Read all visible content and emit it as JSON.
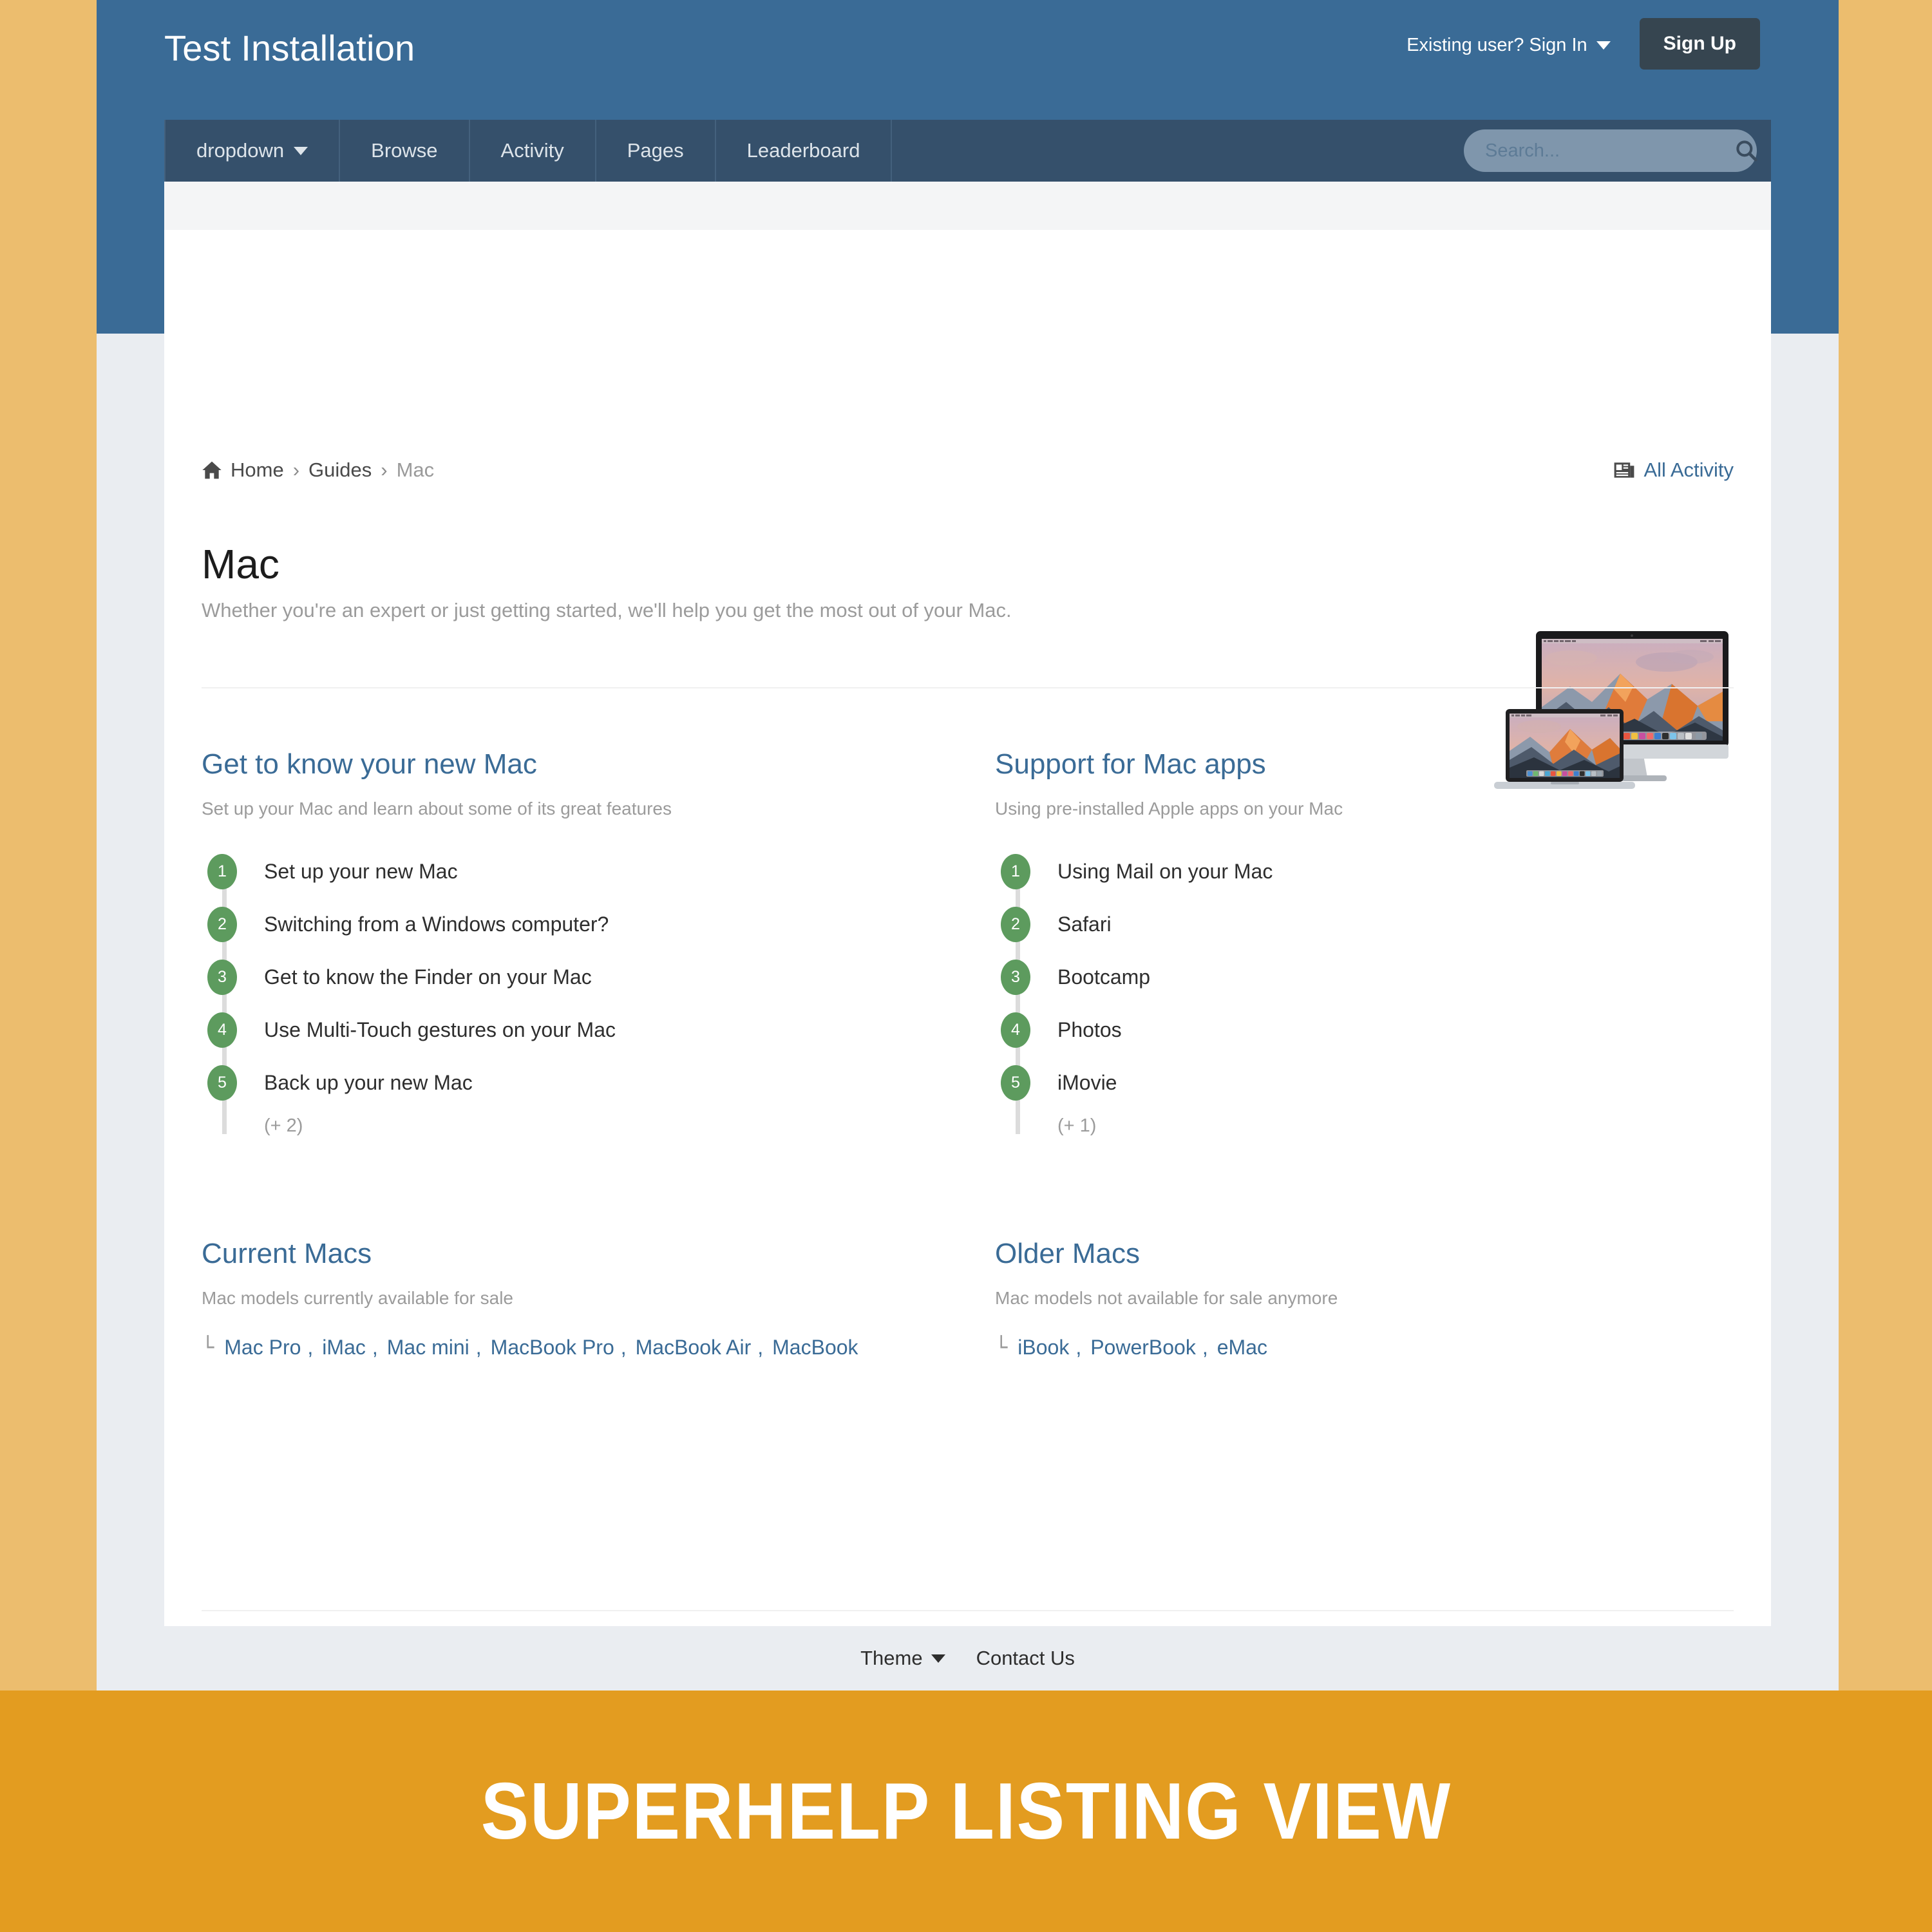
{
  "colors": {
    "header_blue": "#3a6b96",
    "nav_blue": "#35506b",
    "signup_dark": "#364550",
    "page_bg": "#eaedf1",
    "side_margin_gold": "#ecbd6e",
    "banner_orange": "#e39c20",
    "link_blue": "#3a6b96",
    "badge_green": "#5d9b5e",
    "muted_text": "#9b9b9b"
  },
  "header": {
    "site_title": "Test Installation",
    "signin_label": "Existing user? Sign In",
    "signup_label": "Sign Up"
  },
  "nav": {
    "tabs": [
      {
        "label": "dropdown",
        "has_caret": true
      },
      {
        "label": "Browse",
        "has_caret": false
      },
      {
        "label": "Activity",
        "has_caret": false
      },
      {
        "label": "Pages",
        "has_caret": false
      },
      {
        "label": "Leaderboard",
        "has_caret": false
      }
    ],
    "search": {
      "placeholder": "Search...",
      "value": ""
    }
  },
  "breadcrumb": {
    "home": "Home",
    "separator": "›",
    "guides": "Guides",
    "current": "Mac",
    "all_activity": "All Activity"
  },
  "hero": {
    "title": "Mac",
    "subtitle": "Whether you're an expert or just getting started, we'll help you get the most out of your Mac.",
    "image_alt": "imac-and-macbook-sierra-wallpaper"
  },
  "sections": [
    {
      "id": "get-to-know-your-new-mac",
      "title": "Get to know your new Mac",
      "description": "Set up your Mac and learn about some of its great features",
      "items": [
        {
          "num": "1",
          "label": "Set up your new Mac"
        },
        {
          "num": "2",
          "label": "Switching from a Windows computer?"
        },
        {
          "num": "3",
          "label": "Get to know the Finder on your Mac"
        },
        {
          "num": "4",
          "label": "Use Multi-Touch gestures on your Mac"
        },
        {
          "num": "5",
          "label": "Back up your new Mac"
        }
      ],
      "more": "(+ 2)"
    },
    {
      "id": "support-for-mac-apps",
      "title": "Support for Mac apps",
      "description": "Using pre-installed Apple apps on your Mac",
      "items": [
        {
          "num": "1",
          "label": "Using Mail on your Mac"
        },
        {
          "num": "2",
          "label": "Safari"
        },
        {
          "num": "3",
          "label": "Bootcamp"
        },
        {
          "num": "4",
          "label": "Photos"
        },
        {
          "num": "5",
          "label": "iMovie"
        }
      ],
      "more": "(+ 1)"
    },
    {
      "id": "current-macs",
      "title": "Current Macs",
      "description": "Mac models currently available for sale",
      "tree_glyph": "└",
      "links": [
        "Mac Pro",
        "iMac",
        "Mac mini",
        "MacBook Pro",
        "MacBook Air",
        "MacBook"
      ]
    },
    {
      "id": "older-macs",
      "title": "Older Macs",
      "description": "Mac models not available for sale anymore",
      "tree_glyph": "└",
      "links": [
        "iBook",
        "PowerBook",
        "eMac"
      ]
    }
  ],
  "footer": {
    "theme_label": "Theme",
    "contact_label": "Contact Us"
  },
  "banner": {
    "text": "SUPERHELP LISTING VIEW"
  }
}
